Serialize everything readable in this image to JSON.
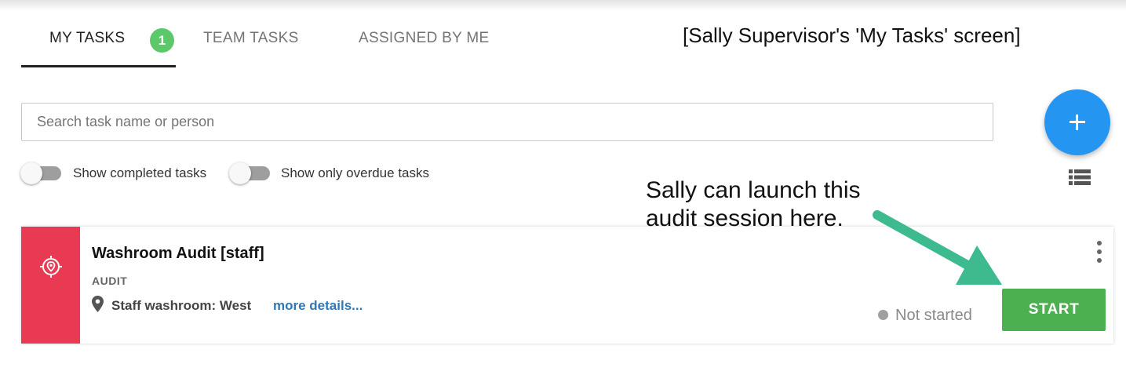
{
  "tabs": {
    "my_tasks": "MY TASKS",
    "my_tasks_count": "1",
    "team_tasks": "TEAM TASKS",
    "assigned_by_me": "ASSIGNED BY ME"
  },
  "annotations": {
    "screen_label": "[Sally Supervisor's 'My Tasks' screen]",
    "note_line1": "Sally can launch this",
    "note_line2": "audit session here."
  },
  "search": {
    "placeholder": "Search task name or person",
    "value": ""
  },
  "filters": {
    "show_completed_label": "Show completed tasks",
    "show_completed_on": false,
    "show_overdue_label": "Show only overdue tasks",
    "show_overdue_on": false
  },
  "task": {
    "title": "Washroom Audit [staff]",
    "type": "AUDIT",
    "location": "Staff washroom: West",
    "more_link": "more details...",
    "status": "Not started",
    "action_label": "START"
  },
  "colors": {
    "accent_blue": "#2496f2",
    "badge_green": "#5cc86a",
    "start_green": "#4caf50",
    "task_red": "#e83a52",
    "arrow_teal": "#3dbb8f",
    "link_blue": "#2f78b6"
  },
  "icons": {
    "add": "plus-icon",
    "view": "list-view-icon",
    "task": "target-pin-icon",
    "location": "map-pin-icon",
    "menu": "more-vert-icon"
  }
}
